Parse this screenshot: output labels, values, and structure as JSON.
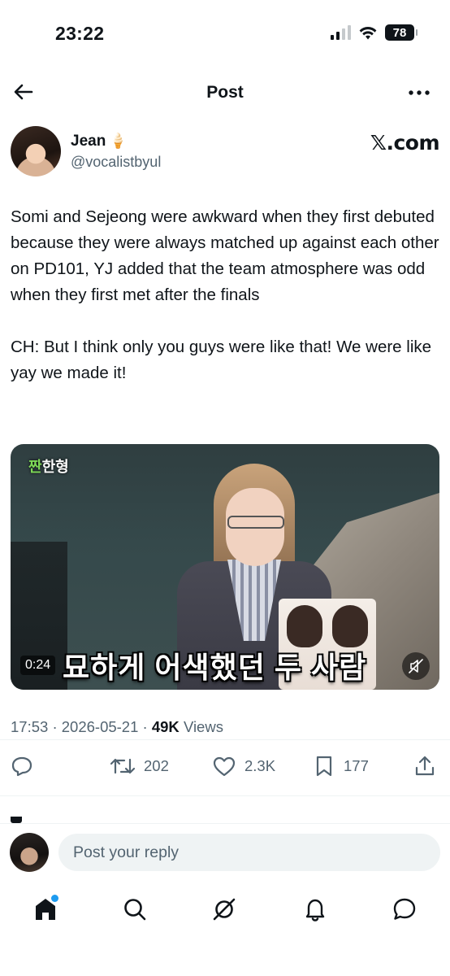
{
  "status_bar": {
    "time": "23:22",
    "battery": "78"
  },
  "header": {
    "title": "Post",
    "back_icon": "arrow-left-icon",
    "more_icon": "more-horizontal-icon"
  },
  "author": {
    "name": "Jean",
    "emoji": "🍦",
    "handle": "@vocalistbyul",
    "source_label": "𝕏.com"
  },
  "post": {
    "paragraphs": [
      "Somi and Sejeong were awkward when they first debuted because they were always matched up against each other on PD101, YJ added that the team atmosphere was odd when they first met after the finals",
      "CH: But I think only you guys were like that! We were like yay we made it!"
    ]
  },
  "video": {
    "logo_accent": "짠",
    "logo_rest": "한형",
    "subtitle": "묘하게 어색했던 두 사람",
    "duration": "0:24",
    "mute_icon": "mute-icon"
  },
  "meta": {
    "time": "17:53",
    "date": "2026-05-21",
    "views_count": "49K",
    "views_label": "Views",
    "separator": "·"
  },
  "actions": {
    "reply_icon": "reply-icon",
    "repost_count": "202",
    "like_count": "2.3K",
    "bookmark_count": "177",
    "share_icon": "share-icon"
  },
  "reply": {
    "placeholder": "Post your reply"
  },
  "bottom_nav": {
    "items": [
      "home-icon",
      "search-icon",
      "grok-icon",
      "notifications-icon",
      "messages-icon"
    ]
  },
  "colors": {
    "text_primary": "#0f1419",
    "text_secondary": "#536471",
    "accent": "#1d9bf0",
    "input_bg": "#eff3f4"
  }
}
